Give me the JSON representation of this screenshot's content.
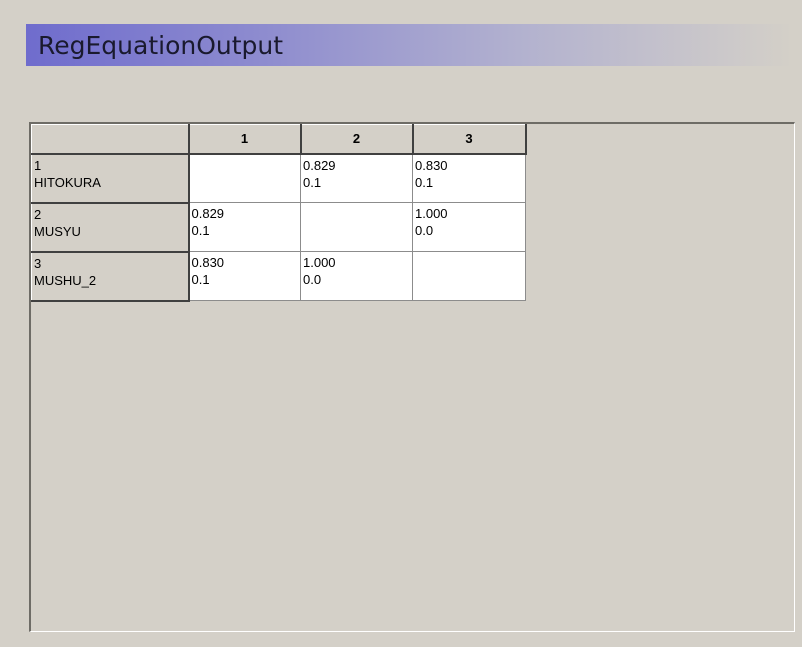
{
  "window": {
    "title": "RegEquationOutput"
  },
  "grid": {
    "corner_label": "",
    "columns": [
      "1",
      "2",
      "3"
    ],
    "rows": [
      {
        "index": "1",
        "name": "HITOKURA",
        "cells": [
          {
            "value": "",
            "sub": ""
          },
          {
            "value": "0.829",
            "sub": "0.1"
          },
          {
            "value": "0.830",
            "sub": "0.1"
          }
        ]
      },
      {
        "index": "2",
        "name": "MUSYU",
        "cells": [
          {
            "value": "0.829",
            "sub": "0.1"
          },
          {
            "value": "",
            "sub": ""
          },
          {
            "value": "1.000",
            "sub": "0.0"
          }
        ]
      },
      {
        "index": "3",
        "name": "MUSHU_2",
        "cells": [
          {
            "value": "0.830",
            "sub": "0.1"
          },
          {
            "value": "1.000",
            "sub": "0.0"
          },
          {
            "value": "",
            "sub": ""
          }
        ]
      }
    ]
  },
  "colors": {
    "background": "#d4d0c8",
    "title_gradient_start": "#6f6ccd",
    "cell_background": "#ffffff"
  }
}
